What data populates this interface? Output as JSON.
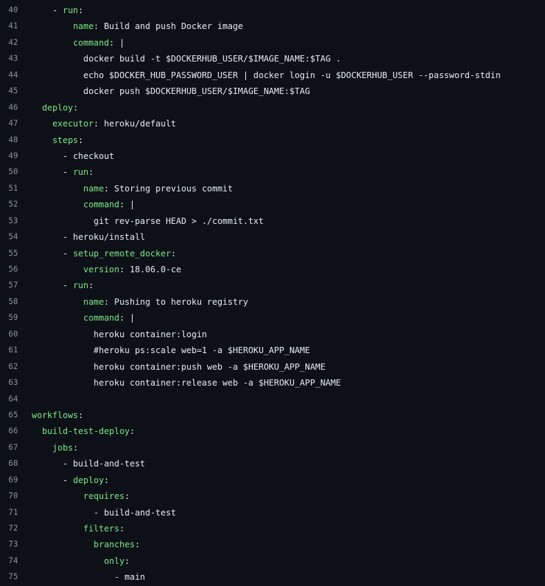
{
  "colors": {
    "background": "#0d1117",
    "line_number": "#8b949e",
    "key": "#7ee787",
    "text": "#e6edf3"
  },
  "lines": [
    {
      "num": "40",
      "indent": "    ",
      "tokens": [
        {
          "t": "- ",
          "c": "text"
        },
        {
          "t": "run",
          "c": "key"
        },
        {
          "t": ":",
          "c": "text"
        }
      ]
    },
    {
      "num": "41",
      "indent": "        ",
      "tokens": [
        {
          "t": "name",
          "c": "key"
        },
        {
          "t": ": Build and push Docker image",
          "c": "text"
        }
      ]
    },
    {
      "num": "42",
      "indent": "        ",
      "tokens": [
        {
          "t": "command",
          "c": "key"
        },
        {
          "t": ": |",
          "c": "text"
        }
      ]
    },
    {
      "num": "43",
      "indent": "          ",
      "tokens": [
        {
          "t": "docker build -t $DOCKERHUB_USER/$IMAGE_NAME:$TAG .",
          "c": "text"
        }
      ]
    },
    {
      "num": "44",
      "indent": "          ",
      "tokens": [
        {
          "t": "echo $DOCKER_HUB_PASSWORD_USER | docker login -u $DOCKERHUB_USER --password-stdin",
          "c": "text"
        }
      ]
    },
    {
      "num": "45",
      "indent": "          ",
      "tokens": [
        {
          "t": "docker push $DOCKERHUB_USER/$IMAGE_NAME:$TAG",
          "c": "text"
        }
      ]
    },
    {
      "num": "46",
      "indent": "  ",
      "tokens": [
        {
          "t": "deploy",
          "c": "key"
        },
        {
          "t": ":",
          "c": "text"
        }
      ]
    },
    {
      "num": "47",
      "indent": "    ",
      "tokens": [
        {
          "t": "executor",
          "c": "key"
        },
        {
          "t": ": heroku/default",
          "c": "text"
        }
      ]
    },
    {
      "num": "48",
      "indent": "    ",
      "tokens": [
        {
          "t": "steps",
          "c": "key"
        },
        {
          "t": ":",
          "c": "text"
        }
      ]
    },
    {
      "num": "49",
      "indent": "      ",
      "tokens": [
        {
          "t": "- checkout",
          "c": "text"
        }
      ]
    },
    {
      "num": "50",
      "indent": "      ",
      "tokens": [
        {
          "t": "- ",
          "c": "text"
        },
        {
          "t": "run",
          "c": "key"
        },
        {
          "t": ":",
          "c": "text"
        }
      ]
    },
    {
      "num": "51",
      "indent": "          ",
      "tokens": [
        {
          "t": "name",
          "c": "key"
        },
        {
          "t": ": Storing previous commit",
          "c": "text"
        }
      ]
    },
    {
      "num": "52",
      "indent": "          ",
      "tokens": [
        {
          "t": "command",
          "c": "key"
        },
        {
          "t": ": |",
          "c": "text"
        }
      ]
    },
    {
      "num": "53",
      "indent": "            ",
      "tokens": [
        {
          "t": "git rev-parse HEAD > ./commit.txt",
          "c": "text"
        }
      ]
    },
    {
      "num": "54",
      "indent": "      ",
      "tokens": [
        {
          "t": "- heroku/install",
          "c": "text"
        }
      ]
    },
    {
      "num": "55",
      "indent": "      ",
      "tokens": [
        {
          "t": "- ",
          "c": "text"
        },
        {
          "t": "setup_remote_docker",
          "c": "key"
        },
        {
          "t": ":",
          "c": "text"
        }
      ]
    },
    {
      "num": "56",
      "indent": "          ",
      "tokens": [
        {
          "t": "version",
          "c": "key"
        },
        {
          "t": ": 18.06.0-ce",
          "c": "text"
        }
      ]
    },
    {
      "num": "57",
      "indent": "      ",
      "tokens": [
        {
          "t": "- ",
          "c": "text"
        },
        {
          "t": "run",
          "c": "key"
        },
        {
          "t": ":",
          "c": "text"
        }
      ]
    },
    {
      "num": "58",
      "indent": "          ",
      "tokens": [
        {
          "t": "name",
          "c": "key"
        },
        {
          "t": ": Pushing to heroku registry",
          "c": "text"
        }
      ]
    },
    {
      "num": "59",
      "indent": "          ",
      "tokens": [
        {
          "t": "command",
          "c": "key"
        },
        {
          "t": ": |",
          "c": "text"
        }
      ]
    },
    {
      "num": "60",
      "indent": "            ",
      "tokens": [
        {
          "t": "heroku container:login",
          "c": "text"
        }
      ]
    },
    {
      "num": "61",
      "indent": "            ",
      "tokens": [
        {
          "t": "#heroku ps:scale web=1 -a $HEROKU_APP_NAME",
          "c": "text"
        }
      ]
    },
    {
      "num": "62",
      "indent": "            ",
      "tokens": [
        {
          "t": "heroku container:push web -a $HEROKU_APP_NAME",
          "c": "text"
        }
      ]
    },
    {
      "num": "63",
      "indent": "            ",
      "tokens": [
        {
          "t": "heroku container:release web -a $HEROKU_APP_NAME",
          "c": "text"
        }
      ]
    },
    {
      "num": "64",
      "indent": "",
      "tokens": []
    },
    {
      "num": "65",
      "indent": "",
      "tokens": [
        {
          "t": "workflows",
          "c": "key"
        },
        {
          "t": ":",
          "c": "text"
        }
      ]
    },
    {
      "num": "66",
      "indent": "  ",
      "tokens": [
        {
          "t": "build-test-deploy",
          "c": "key"
        },
        {
          "t": ":",
          "c": "text"
        }
      ]
    },
    {
      "num": "67",
      "indent": "    ",
      "tokens": [
        {
          "t": "jobs",
          "c": "key"
        },
        {
          "t": ":",
          "c": "text"
        }
      ]
    },
    {
      "num": "68",
      "indent": "      ",
      "tokens": [
        {
          "t": "- build-and-test",
          "c": "text"
        }
      ]
    },
    {
      "num": "69",
      "indent": "      ",
      "tokens": [
        {
          "t": "- ",
          "c": "text"
        },
        {
          "t": "deploy",
          "c": "key"
        },
        {
          "t": ":",
          "c": "text"
        }
      ]
    },
    {
      "num": "70",
      "indent": "          ",
      "tokens": [
        {
          "t": "requires",
          "c": "key"
        },
        {
          "t": ":",
          "c": "text"
        }
      ]
    },
    {
      "num": "71",
      "indent": "            ",
      "tokens": [
        {
          "t": "- build-and-test",
          "c": "text"
        }
      ]
    },
    {
      "num": "72",
      "indent": "          ",
      "tokens": [
        {
          "t": "filters",
          "c": "key"
        },
        {
          "t": ":",
          "c": "text"
        }
      ]
    },
    {
      "num": "73",
      "indent": "            ",
      "tokens": [
        {
          "t": "branches",
          "c": "key"
        },
        {
          "t": ":",
          "c": "text"
        }
      ]
    },
    {
      "num": "74",
      "indent": "              ",
      "tokens": [
        {
          "t": "only",
          "c": "key"
        },
        {
          "t": ":",
          "c": "text"
        }
      ]
    },
    {
      "num": "75",
      "indent": "                ",
      "tokens": [
        {
          "t": "- main",
          "c": "text"
        }
      ]
    }
  ]
}
